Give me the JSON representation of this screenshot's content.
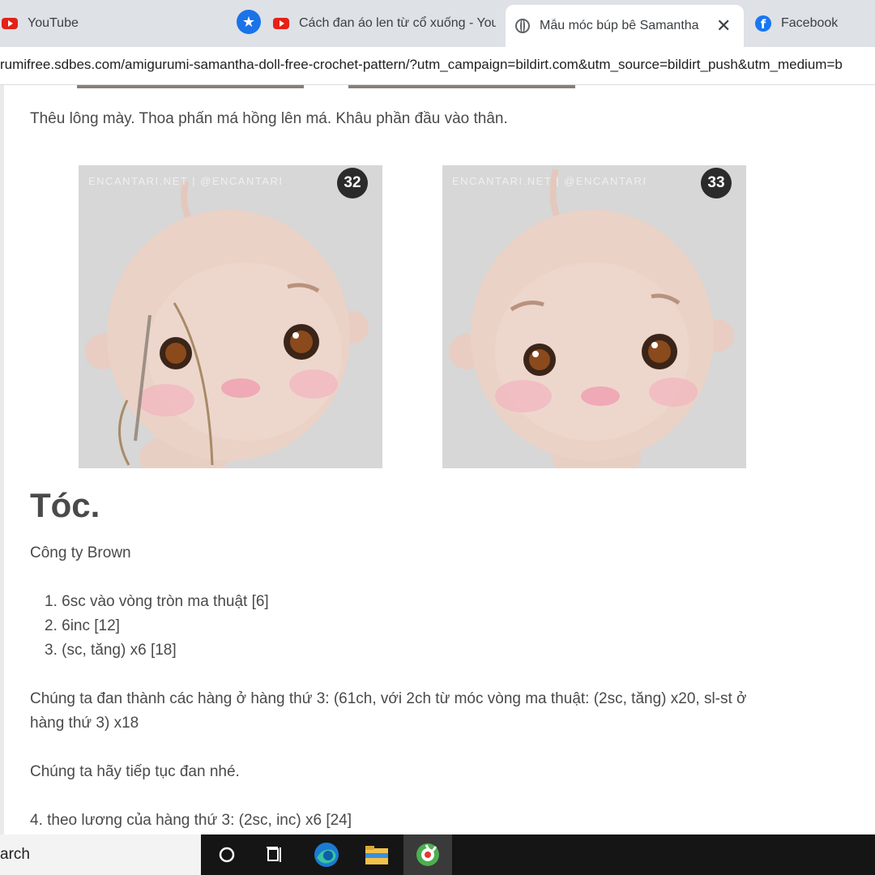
{
  "browser": {
    "tabs": [
      {
        "label": "YouTube",
        "icon": "youtube-icon"
      },
      {
        "label": "Cách đan áo len từ cổ xuống - You",
        "icon": "youtube-icon"
      },
      {
        "label": "Mẫu móc búp bê Samantha /",
        "icon": "globe-icon",
        "active": true
      },
      {
        "label": "Facebook",
        "icon": "facebook-icon"
      }
    ],
    "url": "rumifree.sdbes.com/amigurumi-samantha-doll-free-crochet-pattern/?utm_campaign=bildirt.com&utm_source=bildirt_push&utm_medium=b"
  },
  "article": {
    "intro": "Thêu lông mày. Thoa phấn má hồng lên má. Khâu phần đầu vào thân.",
    "images": [
      {
        "watermark": "ENCANTARI.NET | @ENCANTARI",
        "number": "32"
      },
      {
        "watermark": "ENCANTARI.NET | @ENCANTARI",
        "number": "33"
      }
    ],
    "heading": "Tóc.",
    "yarn": "Công ty Brown",
    "steps": [
      "1. 6sc vào vòng tròn ma thuật [6]",
      "2. 6inc [12]",
      "3. (sc, tăng) x6 [18]"
    ],
    "para_rows_line1": "Chúng ta đan thành các hàng ở hàng thứ 3: (61ch, với 2ch từ móc vòng ma thuật: (2sc, tăng) x20, sl-st ở",
    "para_rows_line2": "hàng thứ 3) x18",
    "para_continue": "Chúng ta hãy tiếp tục đan nhé.",
    "step4": "4. theo lương của hàng thứ 3: (2sc, inc) x6 [24]"
  },
  "taskbar": {
    "search_text": "arch",
    "items": [
      "task-view-icon",
      "edge-icon",
      "file-explorer-icon",
      "app-icon"
    ]
  },
  "colors": {
    "tabstrip": "#dee1e6",
    "accent": "#1a73e8",
    "taskbar": "#151515",
    "text": "#4a4a4a"
  }
}
